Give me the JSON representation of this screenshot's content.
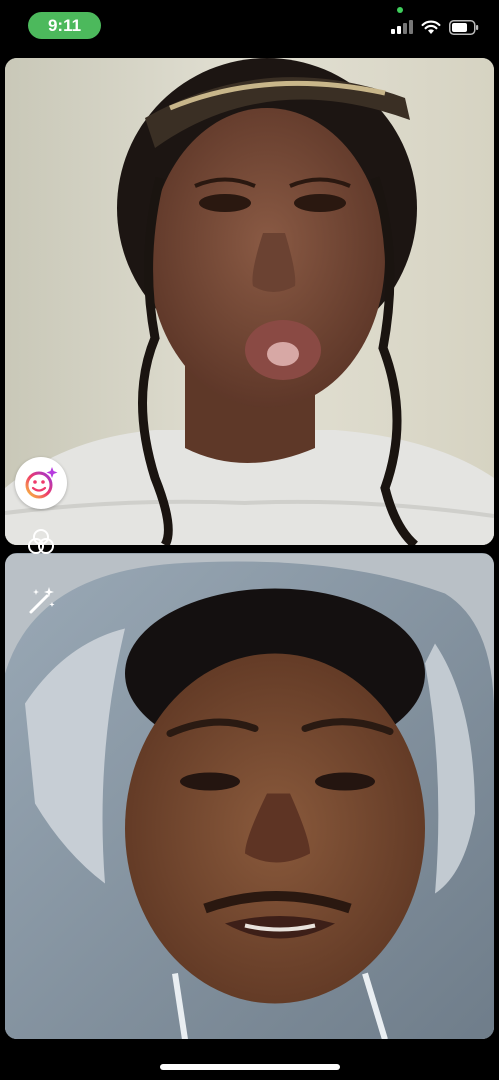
{
  "status_bar": {
    "time": "9:11",
    "time_pill_color": "#4cb95c",
    "icons": [
      "cellular-signal-icon",
      "wifi-icon",
      "battery-icon"
    ],
    "privacy_dot_color": "#3fcf5c"
  },
  "video_call": {
    "remote_video": {
      "icon": "remote-participant-video"
    },
    "self_video": {
      "icon": "self-participant-video"
    }
  },
  "controls": {
    "effects_icon": "face-effects-sparkle-icon",
    "filters_icon": "color-filters-icon",
    "touch_up_icon": "magic-wand-icon"
  },
  "home_indicator": {
    "color": "#ffffff"
  }
}
